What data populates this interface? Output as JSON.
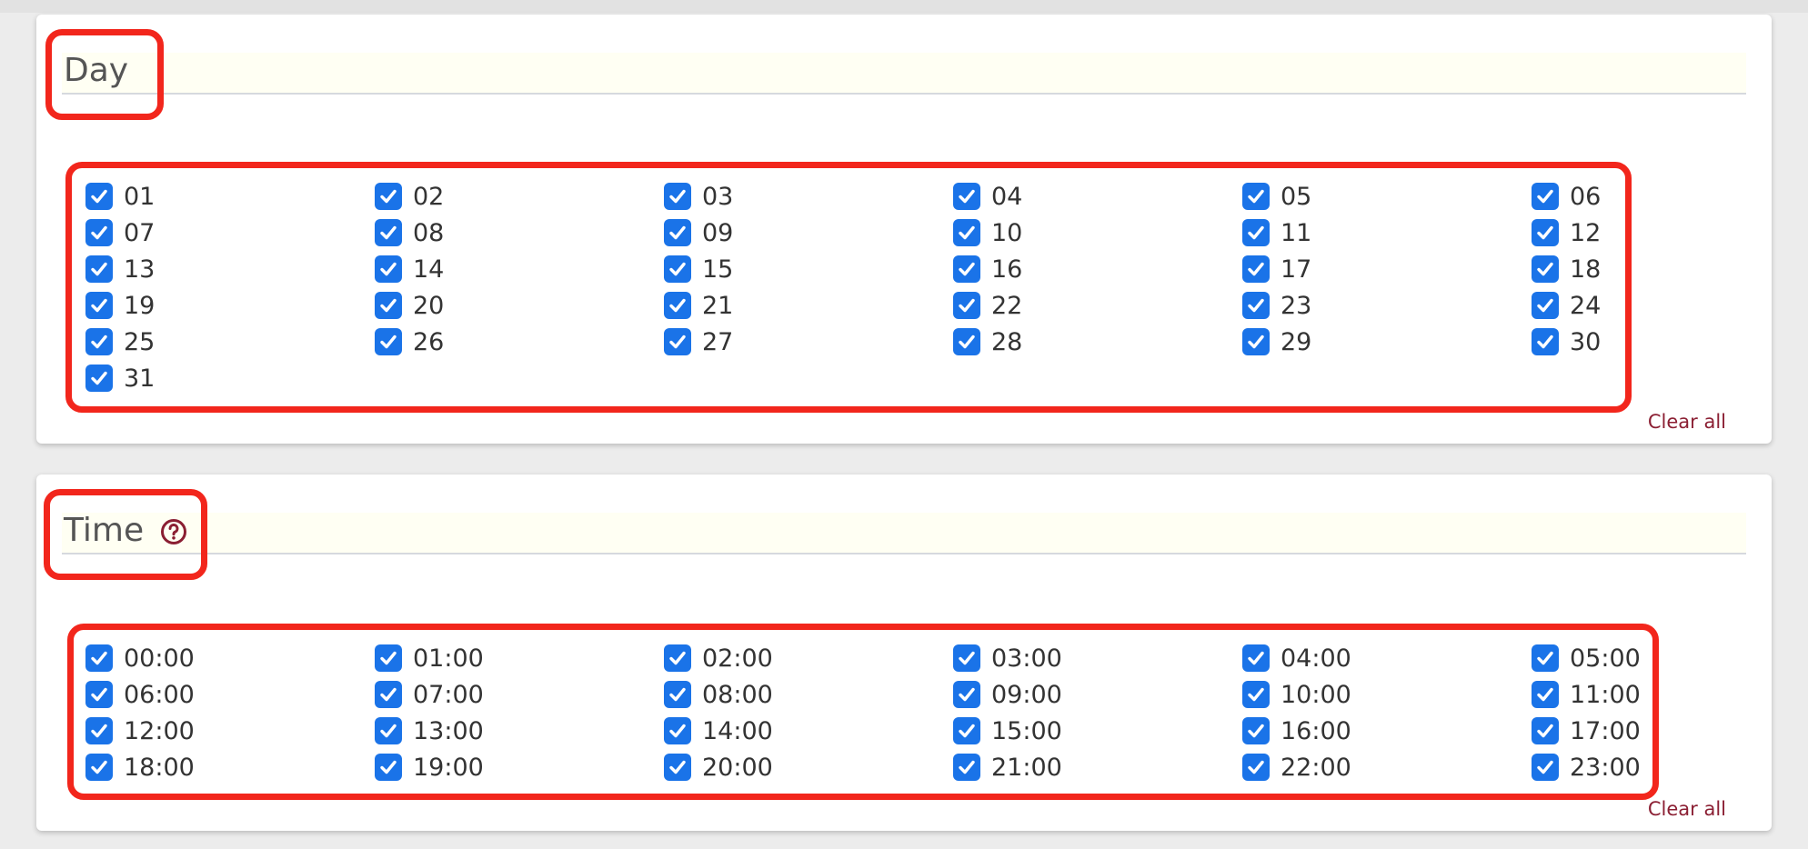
{
  "day_section": {
    "title": "Day",
    "clear_all": "Clear all",
    "options": [
      {
        "label": "01",
        "checked": true
      },
      {
        "label": "02",
        "checked": true
      },
      {
        "label": "03",
        "checked": true
      },
      {
        "label": "04",
        "checked": true
      },
      {
        "label": "05",
        "checked": true
      },
      {
        "label": "06",
        "checked": true
      },
      {
        "label": "07",
        "checked": true
      },
      {
        "label": "08",
        "checked": true
      },
      {
        "label": "09",
        "checked": true
      },
      {
        "label": "10",
        "checked": true
      },
      {
        "label": "11",
        "checked": true
      },
      {
        "label": "12",
        "checked": true
      },
      {
        "label": "13",
        "checked": true
      },
      {
        "label": "14",
        "checked": true
      },
      {
        "label": "15",
        "checked": true
      },
      {
        "label": "16",
        "checked": true
      },
      {
        "label": "17",
        "checked": true
      },
      {
        "label": "18",
        "checked": true
      },
      {
        "label": "19",
        "checked": true
      },
      {
        "label": "20",
        "checked": true
      },
      {
        "label": "21",
        "checked": true
      },
      {
        "label": "22",
        "checked": true
      },
      {
        "label": "23",
        "checked": true
      },
      {
        "label": "24",
        "checked": true
      },
      {
        "label": "25",
        "checked": true
      },
      {
        "label": "26",
        "checked": true
      },
      {
        "label": "27",
        "checked": true
      },
      {
        "label": "28",
        "checked": true
      },
      {
        "label": "29",
        "checked": true
      },
      {
        "label": "30",
        "checked": true
      },
      {
        "label": "31",
        "checked": true
      }
    ]
  },
  "time_section": {
    "title": "Time",
    "help_icon": "question-circle-icon",
    "clear_all": "Clear all",
    "options": [
      {
        "label": "00:00",
        "checked": true
      },
      {
        "label": "01:00",
        "checked": true
      },
      {
        "label": "02:00",
        "checked": true
      },
      {
        "label": "03:00",
        "checked": true
      },
      {
        "label": "04:00",
        "checked": true
      },
      {
        "label": "05:00",
        "checked": true
      },
      {
        "label": "06:00",
        "checked": true
      },
      {
        "label": "07:00",
        "checked": true
      },
      {
        "label": "08:00",
        "checked": true
      },
      {
        "label": "09:00",
        "checked": true
      },
      {
        "label": "10:00",
        "checked": true
      },
      {
        "label": "11:00",
        "checked": true
      },
      {
        "label": "12:00",
        "checked": true
      },
      {
        "label": "13:00",
        "checked": true
      },
      {
        "label": "14:00",
        "checked": true
      },
      {
        "label": "15:00",
        "checked": true
      },
      {
        "label": "16:00",
        "checked": true
      },
      {
        "label": "17:00",
        "checked": true
      },
      {
        "label": "18:00",
        "checked": true
      },
      {
        "label": "19:00",
        "checked": true
      },
      {
        "label": "20:00",
        "checked": true
      },
      {
        "label": "21:00",
        "checked": true
      },
      {
        "label": "22:00",
        "checked": true
      },
      {
        "label": "23:00",
        "checked": true
      }
    ]
  },
  "colors": {
    "checkbox": "#1a73e8",
    "link": "#8b1f33",
    "highlight": "#f2261c",
    "header_background": "#fffff3"
  }
}
